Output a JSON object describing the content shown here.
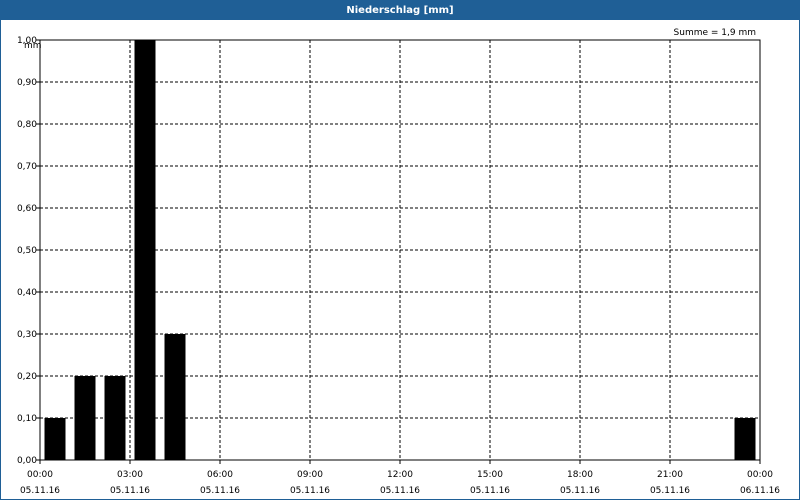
{
  "chart_data": {
    "type": "bar",
    "title": "Niederschlag [mm]",
    "ylabel": "mm",
    "sum_label": "Summe = 1,9 mm",
    "ylim": [
      0,
      1.0
    ],
    "yticks": [
      "0,00",
      "0,10",
      "0,20",
      "0,30",
      "0,40",
      "0,50",
      "0,60",
      "0,70",
      "0,80",
      "0,90",
      "1,00"
    ],
    "xlim_hours": [
      0,
      24
    ],
    "xticks": [
      {
        "time": "00:00",
        "date": "05.11.16"
      },
      {
        "time": "03:00",
        "date": "05.11.16"
      },
      {
        "time": "06:00",
        "date": "05.11.16"
      },
      {
        "time": "09:00",
        "date": "05.11.16"
      },
      {
        "time": "12:00",
        "date": "05.11.16"
      },
      {
        "time": "15:00",
        "date": "05.11.16"
      },
      {
        "time": "18:00",
        "date": "05.11.16"
      },
      {
        "time": "21:00",
        "date": "05.11.16"
      },
      {
        "time": "00:00",
        "date": "06.11.16"
      }
    ],
    "bars": [
      {
        "hour": 0.5,
        "value": 0.1
      },
      {
        "hour": 1.5,
        "value": 0.2
      },
      {
        "hour": 2.5,
        "value": 0.2
      },
      {
        "hour": 3.5,
        "value": 1.0
      },
      {
        "hour": 4.5,
        "value": 0.3
      },
      {
        "hour": 23.5,
        "value": 0.1
      }
    ],
    "bar_color": "#000000",
    "grid": true
  },
  "colors": {
    "titlebar": "#1f5f96"
  }
}
